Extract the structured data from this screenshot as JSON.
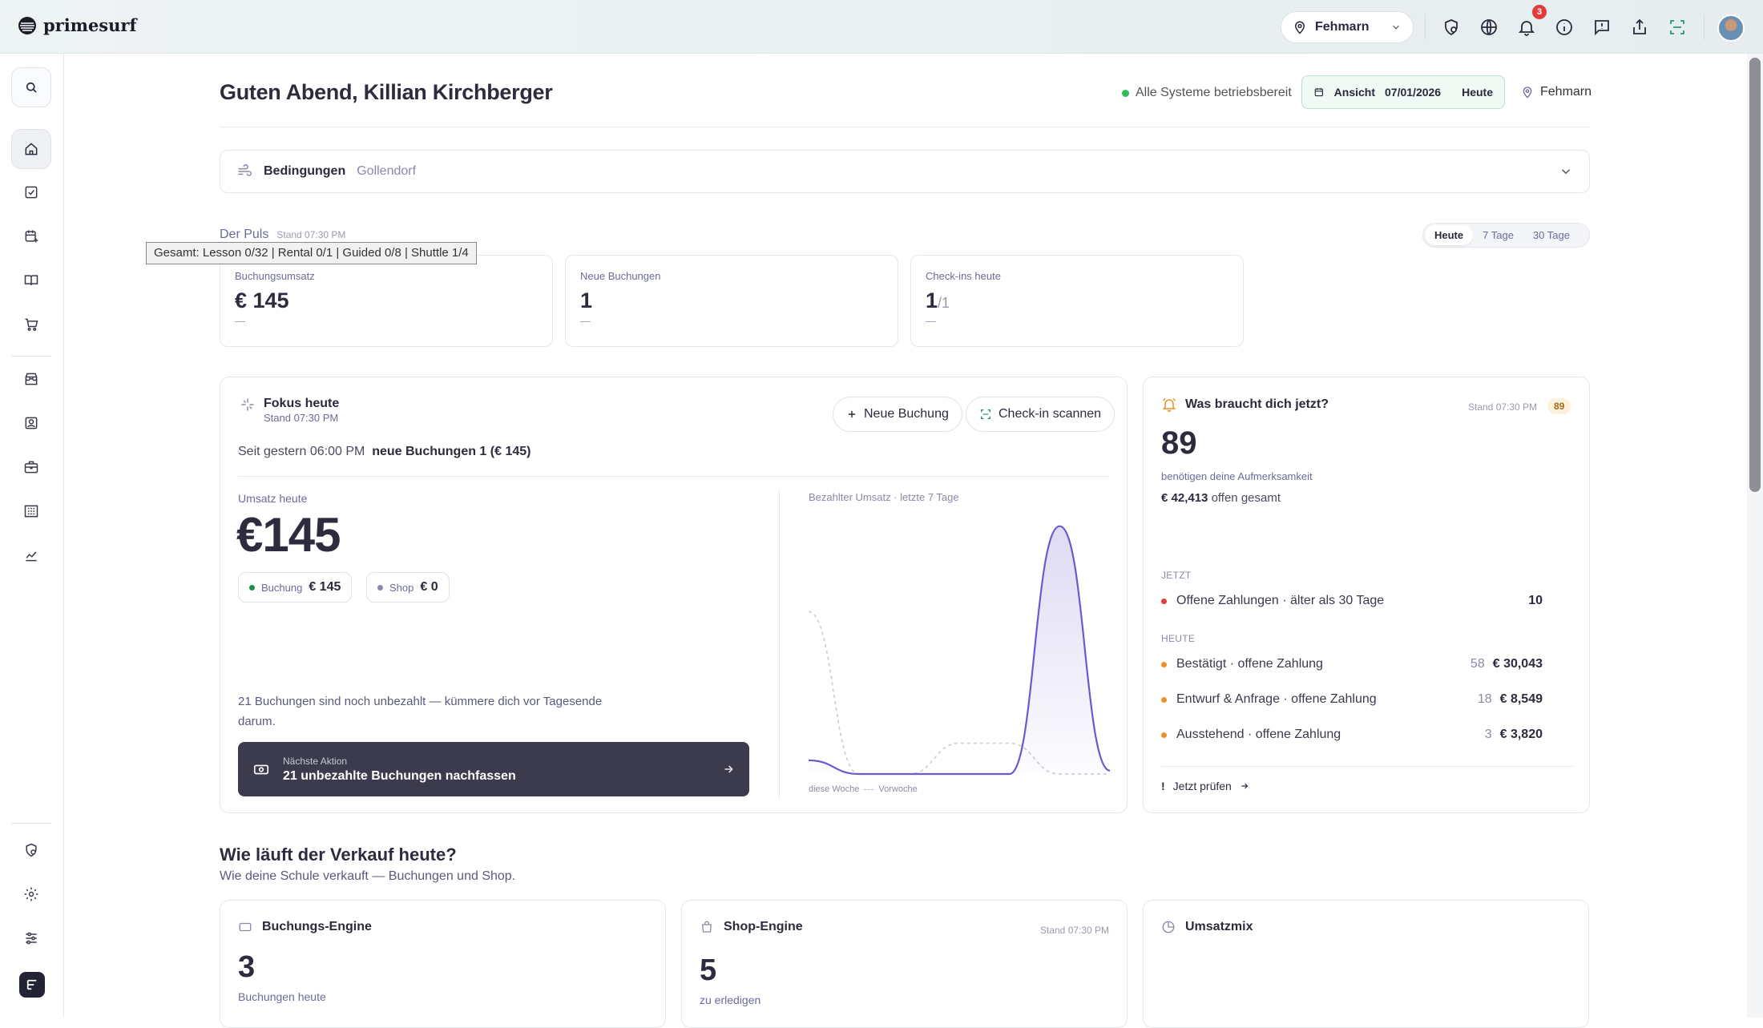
{
  "app": {
    "name": "primesurf"
  },
  "topbar": {
    "location": "Fehmarn",
    "notification_count": "3"
  },
  "header": {
    "greeting": "Guten Abend, Killian Kirchberger",
    "system_status": "Alle Systeme betriebsbereit",
    "view_label": "Ansicht",
    "view_date": "07/01/2026",
    "view_today": "Heute",
    "location": "Fehmarn"
  },
  "conditions": {
    "label": "Bedingungen",
    "place": "Gollendorf"
  },
  "pulse": {
    "title": "Der Puls",
    "stand": "Stand 07:30 PM",
    "tooltip": "Gesamt: Lesson 0/32 | Rental 0/1 | Guided 0/8 | Shuttle 1/4",
    "ranges": [
      "Heute",
      "7 Tage",
      "30 Tage"
    ],
    "kpis": [
      {
        "label": "Buchungsumsatz",
        "value": "€ 145",
        "suffix": "",
        "delta": "—"
      },
      {
        "label": "Neue Buchungen",
        "value": "1",
        "suffix": "",
        "delta": "—"
      },
      {
        "label": "Check-ins heute",
        "value": "1",
        "suffix": "/1",
        "delta": "—"
      }
    ]
  },
  "focus": {
    "title": "Fokus heute",
    "stand": "Stand 07:30 PM",
    "new_booking_button": "Neue Buchung",
    "checkin_button": "Check-in scannen",
    "since_label": "Seit gestern 06:00 PM",
    "since_value": "neue Buchungen 1 (€ 145)",
    "revenue_label": "Umsatz heute",
    "revenue_value": "€145",
    "chip_booking_label": "Buchung",
    "chip_booking_value": "€ 145",
    "chip_shop_label": "Shop",
    "chip_shop_value": "€ 0",
    "unpaid_text": "21 Buchungen sind noch unbezahlt — kümmere dich vor Tagesende darum.",
    "next_action_label": "Nächste Aktion",
    "next_action_text": "21 unbezahlte Buchungen nachfassen",
    "chart_title": "Bezahlter Umsatz · letzte 7 Tage",
    "legend_this": "diese Woche",
    "legend_prev": "Vorwoche"
  },
  "chart_data": {
    "type": "area",
    "title": "Bezahlter Umsatz · letzte 7 Tage",
    "x": [
      1,
      2,
      3,
      4,
      5,
      6,
      7
    ],
    "series": [
      {
        "name": "diese Woche",
        "values": [
          8,
          0,
          0,
          0,
          0,
          145,
          2
        ]
      },
      {
        "name": "Vorwoche",
        "values": [
          95,
          0,
          0,
          18,
          18,
          0,
          0
        ]
      }
    ],
    "ylim": [
      0,
      150
    ],
    "grid": false,
    "legend": "bottom-left"
  },
  "attention": {
    "title": "Was braucht dich jetzt?",
    "stand": "Stand 07:30 PM",
    "badge": "89",
    "count": "89",
    "count_label": "benötigen deine Aufmerksamkeit",
    "open_amount": "€ 42,413",
    "open_label": "offen gesamt",
    "section_now": "JETZT",
    "section_today": "HEUTE",
    "now_items": [
      {
        "label": "Offene Zahlungen · älter als 30 Tage",
        "count": "10",
        "amount": ""
      }
    ],
    "today_items": [
      {
        "label": "Bestätigt · offene Zahlung",
        "count": "58",
        "amount": "€ 30,043"
      },
      {
        "label": "Entwurf & Anfrage · offene Zahlung",
        "count": "18",
        "amount": "€ 8,549"
      },
      {
        "label": "Ausstehend · offene Zahlung",
        "count": "3",
        "amount": "€ 3,820"
      }
    ],
    "check_link": "Jetzt prüfen"
  },
  "sales": {
    "title": "Wie läuft der Verkauf heute?",
    "subtitle": "Wie deine Schule verkauft — Buchungen und Shop.",
    "booking_engine": {
      "title": "Buchungs-Engine",
      "value": "3",
      "sub": "Buchungen heute"
    },
    "shop_engine": {
      "title": "Shop-Engine",
      "stand": "Stand 07:30 PM",
      "value": "5",
      "sub": "zu erledigen"
    },
    "mix": {
      "title": "Umsatzmix"
    }
  },
  "colors": {
    "accent": "#6a5acd",
    "green": "#2fbf5a",
    "red": "#e23b3b",
    "orange": "#e8912d",
    "dark": "#3c3b4e"
  }
}
